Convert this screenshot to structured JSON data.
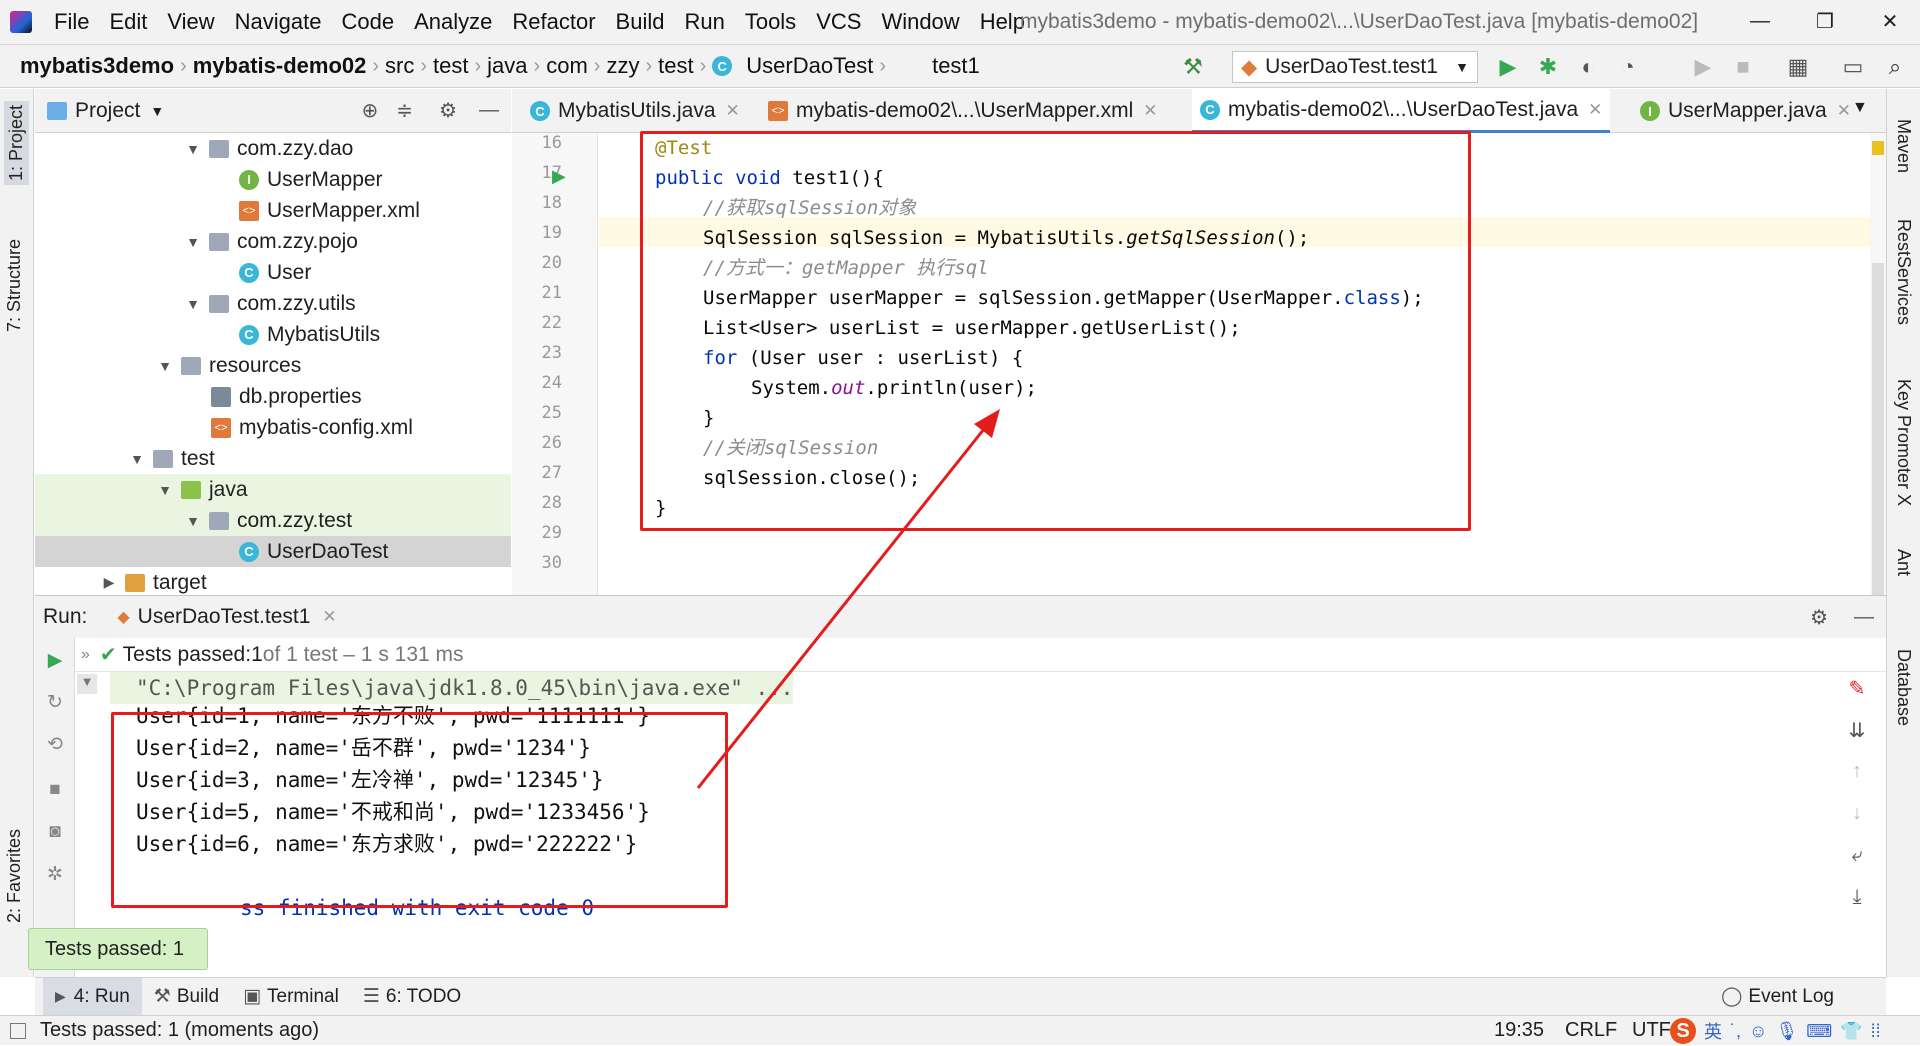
{
  "window": {
    "title": "mybatis3demo - mybatis-demo02\\...\\UserDaoTest.java [mybatis-demo02]",
    "menu": [
      "File",
      "Edit",
      "View",
      "Navigate",
      "Code",
      "Analyze",
      "Refactor",
      "Build",
      "Run",
      "Tools",
      "VCS",
      "Window",
      "Help"
    ]
  },
  "breadcrumb": [
    "mybatis3demo",
    "mybatis-demo02",
    "src",
    "test",
    "java",
    "com",
    "zzy",
    "test",
    "UserDaoTest",
    "test1"
  ],
  "run_config": "UserDaoTest.test1",
  "project_panel": {
    "title": "Project",
    "tree": [
      {
        "label": "com.zzy.dao",
        "type": "package"
      },
      {
        "label": "UserMapper",
        "type": "interface"
      },
      {
        "label": "UserMapper.xml",
        "type": "xml"
      },
      {
        "label": "com.zzy.pojo",
        "type": "package"
      },
      {
        "label": "User",
        "type": "class"
      },
      {
        "label": "com.zzy.utils",
        "type": "package"
      },
      {
        "label": "MybatisUtils",
        "type": "class"
      },
      {
        "label": "resources",
        "type": "folder"
      },
      {
        "label": "db.properties",
        "type": "props"
      },
      {
        "label": "mybatis-config.xml",
        "type": "xml"
      },
      {
        "label": "test",
        "type": "folder"
      },
      {
        "label": "java",
        "type": "srcfolder"
      },
      {
        "label": "com.zzy.test",
        "type": "package"
      },
      {
        "label": "UserDaoTest",
        "type": "class"
      },
      {
        "label": "target",
        "type": "folder"
      }
    ]
  },
  "editor_tabs": [
    "MybatisUtils.java",
    "mybatis-demo02\\...\\UserMapper.xml",
    "mybatis-demo02\\...\\UserDaoTest.java",
    "UserMapper.java"
  ],
  "line_numbers": [
    "16",
    "17",
    "18",
    "19",
    "20",
    "21",
    "22",
    "23",
    "24",
    "25",
    "26",
    "27",
    "28",
    "29",
    "30"
  ],
  "code": {
    "l16": "@Test",
    "l17a": "public void ",
    "l17b": "test1(){",
    "l18": "//获取sqlSession对象",
    "l19a": "SqlSession sqlSession = MybatisUtils.",
    "l19b": "getSqlSession",
    "l19c": "();",
    "l20": "//方式一：getMapper 执行sql",
    "l21a": "UserMapper userMapper = sqlSession.getMapper(UserMapper.",
    "l21b": "class",
    "l21c": ");",
    "l22": "List<User> userList = userMapper.getUserList();",
    "l23a": "for ",
    "l23b": "(User user : userList) {",
    "l24a": "System.",
    "l24b": "out",
    "l24c": ".println(user);",
    "l25": "}",
    "l26": "//关闭sqlSession",
    "l27": "sqlSession.close();",
    "l28": "}"
  },
  "run_panel": {
    "label": "Run:",
    "tab": "UserDaoTest.test1",
    "status_bold": "Tests passed: ",
    "status_count": "1",
    "status_rest": " of 1 test – 1 s 131 ms",
    "console": [
      "\"C:\\Program Files\\java\\jdk1.8.0_45\\bin\\java.exe\" ...",
      "User{id=1, name='东方不败', pwd='1111111'}",
      "User{id=2, name='岳不群', pwd='1234'}",
      "User{id=3, name='左冷禅', pwd='12345'}",
      "User{id=5, name='不戒和尚', pwd='1233456'}",
      "User{id=6, name='东方求败', pwd='222222'}",
      "",
      "ss finished with exit code 0"
    ]
  },
  "left_tabs": [
    "1: Project",
    "7: Structure",
    "2: Favorites"
  ],
  "right_tabs": [
    "Maven",
    "RestServices",
    "Key Promoter X",
    "Ant",
    "Database"
  ],
  "bottom_tabs": [
    "4: Run",
    "Build",
    "Terminal",
    "6: TODO"
  ],
  "event_log": "Event Log",
  "balloon": "Tests passed: 1",
  "status": {
    "message": "Tests passed: 1 (moments ago)",
    "position": "19:35",
    "line_sep": "CRLF",
    "encoding": "UTF"
  },
  "colors": {
    "highlight_red": "#e41c1c",
    "accent_blue": "#4083c9",
    "run_green": "#34a853"
  }
}
